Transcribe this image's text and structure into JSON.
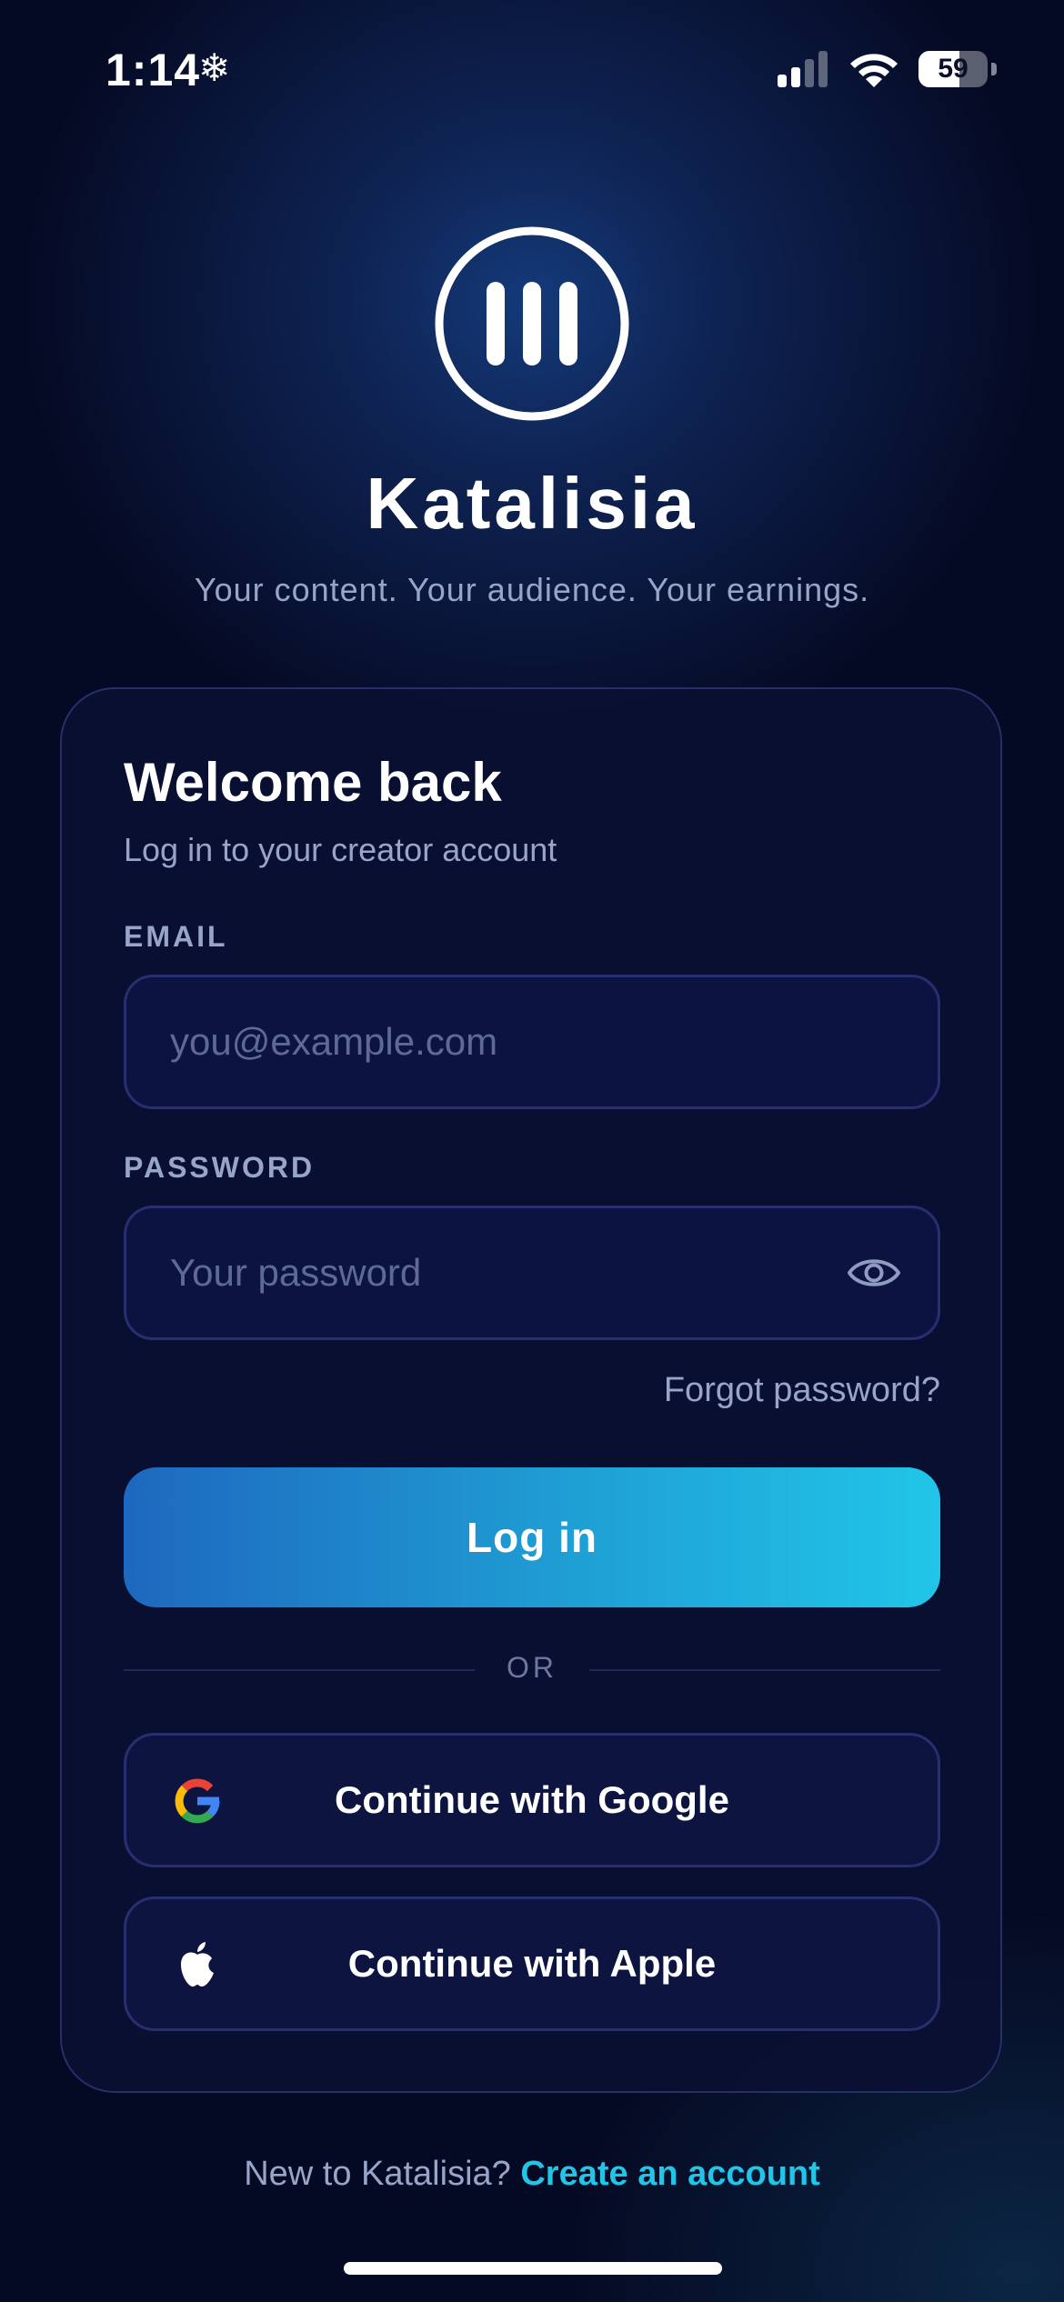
{
  "status_bar": {
    "time": "1:14",
    "activity_icon": "snowflake-icon",
    "signal_icon": "cellular-signal-icon",
    "wifi_icon": "wifi-icon",
    "battery_level": "59",
    "battery_fraction": 0.59
  },
  "brand": {
    "logo_icon": "katalisia-logo-icon",
    "name": "Katalisia",
    "tagline": "Your content. Your audience. Your earnings."
  },
  "login_card": {
    "title": "Welcome back",
    "subtitle": "Log in to your creator account",
    "email": {
      "label": "EMAIL",
      "value": "",
      "placeholder": "you@example.com"
    },
    "password": {
      "label": "PASSWORD",
      "value": "",
      "placeholder": "Your password",
      "toggle_icon": "eye-icon"
    },
    "forgot_password": "Forgot password?",
    "login_button": "Log in",
    "divider_text": "OR",
    "google_button": {
      "label": "Continue with Google",
      "icon": "google-icon"
    },
    "apple_button": {
      "label": "Continue with Apple",
      "icon": "apple-icon"
    }
  },
  "footer": {
    "prompt": "New to Katalisia?",
    "link": "Create an account"
  },
  "colors": {
    "background": "#050a24",
    "accent": "#21c5e8",
    "button_gradient_start": "#1e68bf",
    "button_gradient_end": "#21c5e8",
    "muted_text": "#97a5c8",
    "field_border": "#272f70"
  }
}
